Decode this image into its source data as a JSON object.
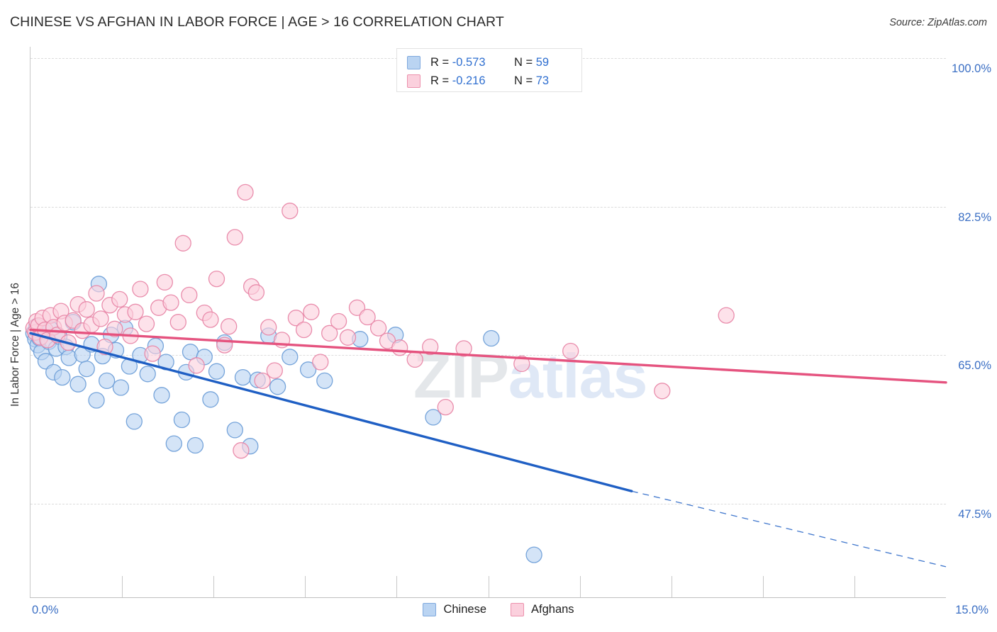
{
  "header": {
    "title": "CHINESE VS AFGHAN IN LABOR FORCE | AGE > 16 CORRELATION CHART",
    "source": "Source: ZipAtlas.com"
  },
  "watermark": {
    "zip": "ZIP",
    "atlas": "atlas"
  },
  "stats_legend": {
    "rows": [
      {
        "color": "#bad4f2",
        "r_label": "R = ",
        "r_value": "-0.573",
        "n_label": "N = ",
        "n_value": "59"
      },
      {
        "color": "#fbd0dd",
        "r_label": "R = ",
        "r_value": "-0.216",
        "n_label": "N = ",
        "n_value": "73"
      }
    ]
  },
  "series_legend": {
    "items": [
      {
        "label": "Chinese",
        "color": "#bad4f2",
        "border": "#7fa9de"
      },
      {
        "label": "Afghans",
        "color": "#fbd0dd",
        "border": "#ec91ad"
      }
    ]
  },
  "axes": {
    "y_title": "In Labor Force | Age > 16",
    "y_ticks": [
      "100.0%",
      "82.5%",
      "65.0%",
      "47.5%"
    ],
    "x_min_label": "0.0%",
    "x_max_label": "15.0%"
  },
  "chart_data": {
    "type": "scatter",
    "title": "CHINESE VS AFGHAN IN LABOR FORCE | AGE > 16 CORRELATION CHART",
    "xlabel": "",
    "ylabel": "In Labor Force | Age > 16",
    "xlim": [
      0.0,
      15.0
    ],
    "ylim": [
      36.5,
      100.0
    ],
    "x_unit": "percent",
    "y_unit": "percent",
    "grid": true,
    "y_gridlines": [
      100.0,
      82.5,
      65.0,
      47.5
    ],
    "legend_position": "bottom-center",
    "series": [
      {
        "name": "Chinese",
        "color": "#bad4f2",
        "border": "#6f9fd8",
        "r": -0.573,
        "n": 59,
        "trendline": {
          "x0": 0.0,
          "y0": 67.6,
          "x1": 9.85,
          "y1": 49.0,
          "style": "solid"
        },
        "trendline_extension": {
          "x0": 9.85,
          "y0": 49.0,
          "x1": 15.0,
          "y1": 40.1,
          "style": "dashed"
        },
        "points": [
          [
            0.05,
            67.6
          ],
          [
            0.08,
            66.9
          ],
          [
            0.1,
            68.4
          ],
          [
            0.12,
            66.2
          ],
          [
            0.15,
            67.0
          ],
          [
            0.18,
            65.4
          ],
          [
            0.22,
            67.8
          ],
          [
            0.25,
            64.3
          ],
          [
            0.3,
            66.6
          ],
          [
            0.33,
            68.1
          ],
          [
            0.38,
            63.0
          ],
          [
            0.42,
            65.8
          ],
          [
            0.47,
            67.2
          ],
          [
            0.52,
            62.4
          ],
          [
            0.58,
            66.0
          ],
          [
            0.63,
            64.7
          ],
          [
            0.7,
            68.9
          ],
          [
            0.78,
            61.6
          ],
          [
            0.85,
            65.1
          ],
          [
            0.92,
            63.4
          ],
          [
            1.0,
            66.3
          ],
          [
            1.08,
            59.7
          ],
          [
            1.12,
            73.4
          ],
          [
            1.18,
            64.9
          ],
          [
            1.25,
            62.0
          ],
          [
            1.32,
            67.4
          ],
          [
            1.4,
            65.6
          ],
          [
            1.48,
            61.2
          ],
          [
            1.55,
            68.2
          ],
          [
            1.62,
            63.7
          ],
          [
            1.7,
            57.2
          ],
          [
            1.8,
            65.0
          ],
          [
            1.92,
            62.8
          ],
          [
            2.05,
            66.1
          ],
          [
            2.15,
            60.3
          ],
          [
            2.22,
            64.2
          ],
          [
            2.35,
            54.6
          ],
          [
            2.48,
            57.4
          ],
          [
            2.55,
            63.0
          ],
          [
            2.62,
            65.4
          ],
          [
            2.7,
            54.4
          ],
          [
            2.85,
            64.8
          ],
          [
            2.95,
            59.8
          ],
          [
            3.05,
            63.1
          ],
          [
            3.18,
            66.5
          ],
          [
            3.35,
            56.2
          ],
          [
            3.48,
            62.4
          ],
          [
            3.6,
            54.3
          ],
          [
            3.72,
            62.1
          ],
          [
            3.9,
            67.3
          ],
          [
            4.05,
            61.3
          ],
          [
            4.25,
            64.8
          ],
          [
            4.55,
            63.3
          ],
          [
            4.82,
            62.0
          ],
          [
            5.4,
            66.9
          ],
          [
            5.98,
            67.4
          ],
          [
            6.6,
            57.7
          ],
          [
            7.55,
            67.0
          ],
          [
            8.25,
            41.5
          ]
        ]
      },
      {
        "name": "Afghans",
        "color": "#fbd0dd",
        "border": "#e887a8",
        "r": -0.216,
        "n": 73,
        "trendline": {
          "x0": 0.0,
          "y0": 68.0,
          "x1": 15.0,
          "y1": 61.8,
          "style": "solid"
        },
        "points": [
          [
            0.05,
            68.2
          ],
          [
            0.08,
            67.7
          ],
          [
            0.1,
            69.0
          ],
          [
            0.13,
            68.5
          ],
          [
            0.16,
            67.1
          ],
          [
            0.2,
            69.4
          ],
          [
            0.24,
            68.0
          ],
          [
            0.28,
            66.8
          ],
          [
            0.33,
            69.7
          ],
          [
            0.38,
            68.3
          ],
          [
            0.44,
            67.4
          ],
          [
            0.5,
            70.2
          ],
          [
            0.56,
            68.8
          ],
          [
            0.62,
            66.5
          ],
          [
            0.7,
            69.1
          ],
          [
            0.78,
            71.0
          ],
          [
            0.85,
            67.9
          ],
          [
            0.92,
            70.4
          ],
          [
            1.0,
            68.6
          ],
          [
            1.08,
            72.3
          ],
          [
            1.15,
            69.3
          ],
          [
            1.22,
            66.0
          ],
          [
            1.3,
            70.9
          ],
          [
            1.38,
            68.1
          ],
          [
            1.46,
            71.6
          ],
          [
            1.55,
            69.8
          ],
          [
            1.64,
            67.3
          ],
          [
            1.72,
            70.1
          ],
          [
            1.8,
            72.8
          ],
          [
            1.9,
            68.7
          ],
          [
            2.0,
            65.2
          ],
          [
            2.1,
            70.6
          ],
          [
            2.2,
            73.6
          ],
          [
            2.3,
            71.2
          ],
          [
            2.42,
            68.9
          ],
          [
            2.5,
            78.2
          ],
          [
            2.6,
            72.1
          ],
          [
            2.72,
            63.8
          ],
          [
            2.85,
            70.0
          ],
          [
            2.95,
            69.2
          ],
          [
            3.05,
            74.0
          ],
          [
            3.18,
            66.2
          ],
          [
            3.25,
            68.4
          ],
          [
            3.35,
            78.9
          ],
          [
            3.45,
            53.8
          ],
          [
            3.52,
            84.2
          ],
          [
            3.62,
            73.1
          ],
          [
            3.7,
            72.4
          ],
          [
            3.8,
            62.0
          ],
          [
            3.9,
            68.3
          ],
          [
            4.0,
            63.2
          ],
          [
            4.12,
            66.8
          ],
          [
            4.25,
            82.0
          ],
          [
            4.35,
            69.4
          ],
          [
            4.48,
            68.0
          ],
          [
            4.6,
            70.1
          ],
          [
            4.75,
            64.2
          ],
          [
            4.9,
            67.6
          ],
          [
            5.05,
            69.0
          ],
          [
            5.2,
            67.1
          ],
          [
            5.35,
            70.6
          ],
          [
            5.52,
            69.5
          ],
          [
            5.7,
            68.2
          ],
          [
            5.85,
            66.7
          ],
          [
            6.05,
            65.9
          ],
          [
            6.3,
            64.5
          ],
          [
            6.55,
            66.0
          ],
          [
            6.8,
            58.9
          ],
          [
            7.1,
            65.8
          ],
          [
            8.05,
            64.0
          ],
          [
            8.85,
            65.5
          ],
          [
            10.35,
            60.8
          ],
          [
            11.4,
            69.7
          ]
        ]
      }
    ]
  }
}
